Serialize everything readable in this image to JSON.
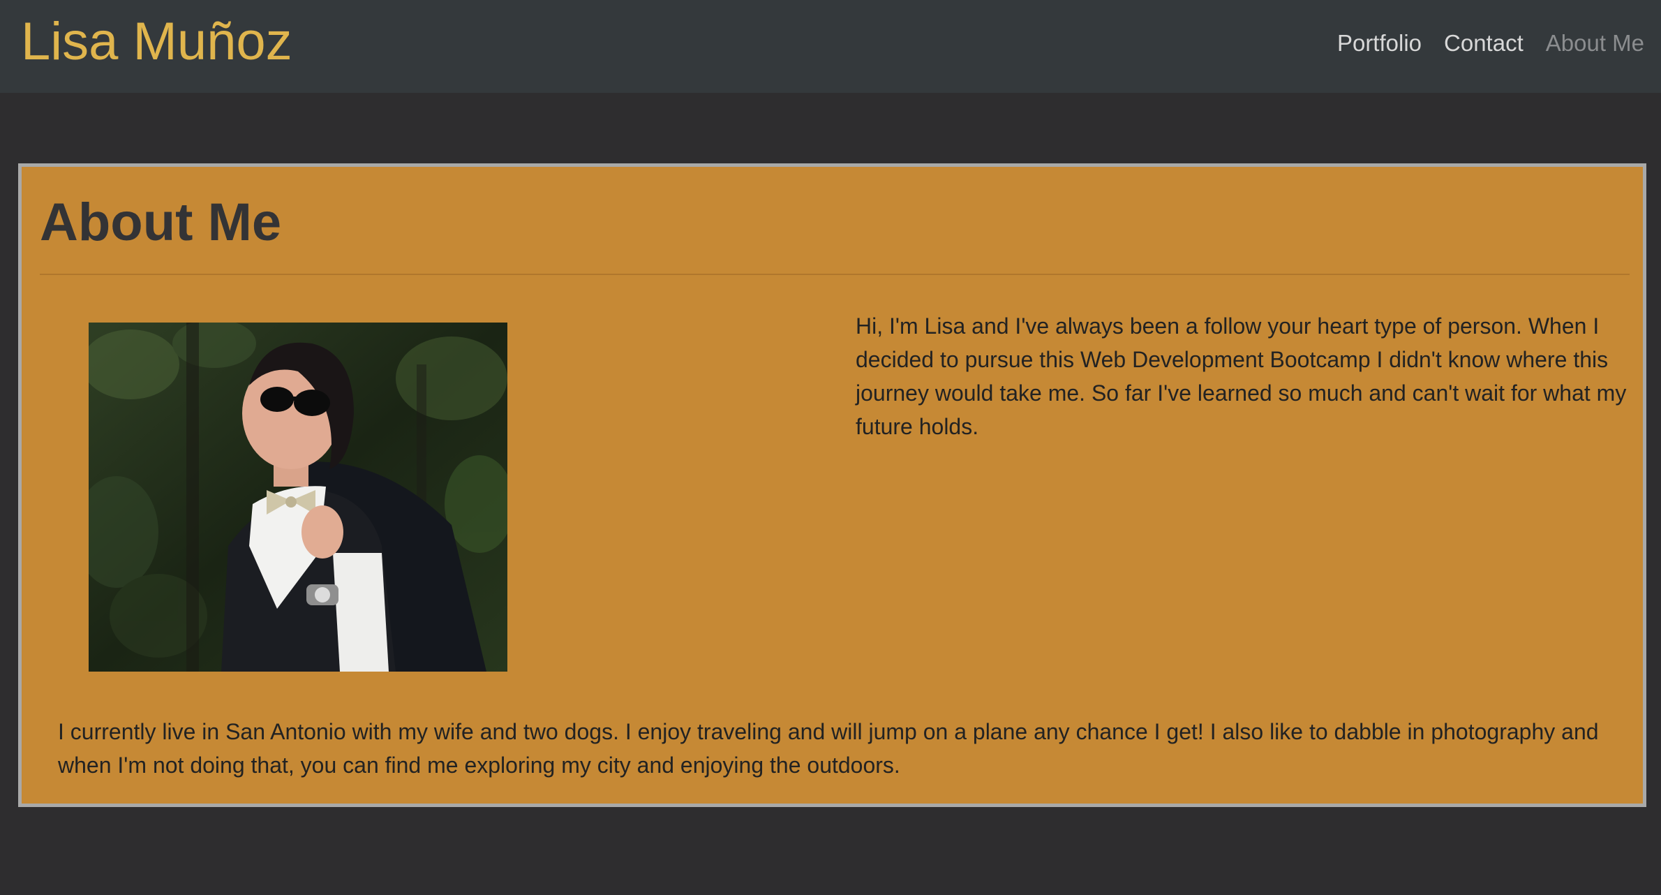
{
  "header": {
    "brand": "Lisa Muñoz",
    "nav": [
      {
        "label": "Portfolio",
        "active": false
      },
      {
        "label": "Contact",
        "active": false
      },
      {
        "label": "About Me",
        "active": true
      }
    ]
  },
  "main": {
    "title": "About Me",
    "photo": {
      "icon": "profile-photo"
    },
    "paragraph_1": "Hi, I'm Lisa and I've always been a follow your heart type of person. When I decided to pursue this Web Development Bootcamp I didn't know where this journey would take me. So far I've learned so much and can't wait for what my future holds.",
    "paragraph_2": "I currently live in San Antonio with my wife and two dogs. I enjoy traveling and will jump on a plane any chance I get! I also like to dabble in photography and when I'm not doing that, you can find me exploring my city and enjoying the outdoors."
  },
  "colors": {
    "navbar": "#34393c",
    "brand": "#e0b54d",
    "page_background": "#2e2d2f",
    "card_background": "#c68935",
    "card_border": "#a9a9a9",
    "nav_link": "#d8d8d8",
    "nav_link_active": "#8b8d8f"
  }
}
